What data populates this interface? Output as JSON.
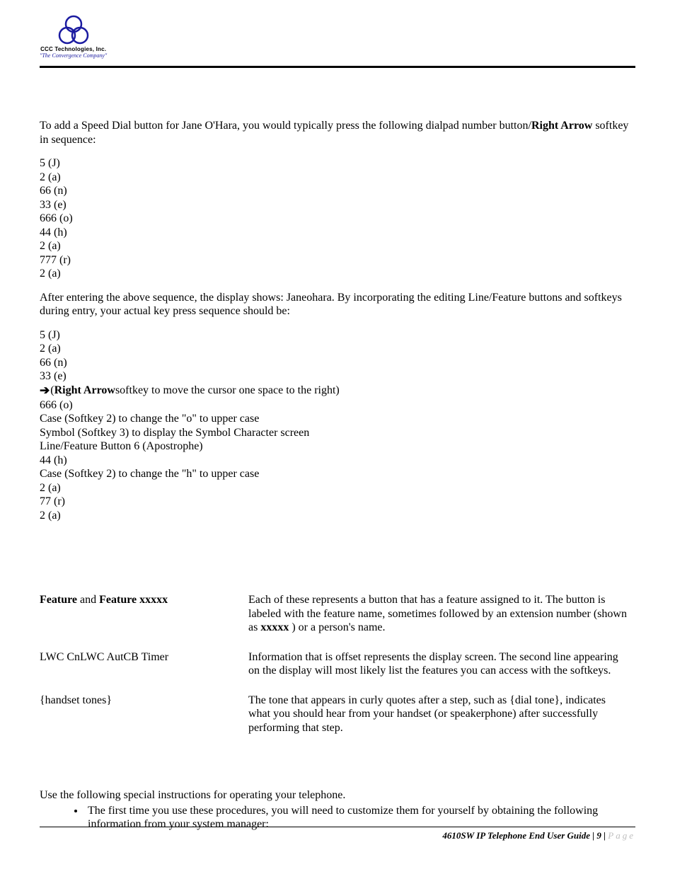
{
  "logo": {
    "company": "CCC Technologies, Inc.",
    "tagline": "\"The Convergence Company\""
  },
  "intro": {
    "pre": "To add a Speed Dial button for Jane O'Hara, you would typically press the following dialpad number button/",
    "bold": "Right Arrow",
    "post": " softkey in sequence:"
  },
  "seq1": [
    "5 (J)",
    "2 (a)",
    "66 (n)",
    "33 (e)",
    "666 (o)",
    "44 (h)",
    "2 (a)",
    "777 (r)",
    "2 (a)"
  ],
  "mid": "After entering the above sequence, the display shows: Janeohara. By incorporating the editing Line/Feature buttons and softkeys during entry, your actual key press sequence should be:",
  "seq2": {
    "l1": "5 (J)",
    "l2": "2 (a)",
    "l3": "66 (n)",
    "l4": "33 (e)",
    "l5_pre": "(",
    "l5_bold": "Right Arrow",
    "l5_post": " softkey to move the cursor one space to the right)",
    "l6": "666 (o)",
    "l7": "Case (Softkey 2) to change the \"o\" to upper case",
    "l8": "Symbol (Softkey 3) to display the Symbol Character screen",
    "l9": "Line/Feature Button 6 (Apostrophe)",
    "l10": "44 (h)",
    "l11": "Case (Softkey 2) to change the \"h\" to upper case",
    "l12": "2 (a)",
    "l13": "77 (r)",
    "l14": "2 (a)"
  },
  "defs": {
    "r1": {
      "term_b1": "Feature",
      "term_mid": " and ",
      "term_b2": "Feature xxxxx",
      "desc_pre": "Each of these represents a button that has a feature assigned to it. The button is labeled with the feature name, sometimes followed by an extension number (shown as ",
      "desc_bold": "xxxxx",
      "desc_post": " ) or a person's name."
    },
    "r2": {
      "term": "LWC CnLWC AutCB Timer",
      "desc": "Information that is offset represents the display screen. The second line appearing on the display will most likely list the features you can access with the softkeys."
    },
    "r3": {
      "term": "{handset tones}",
      "desc": "The tone that appears in curly quotes after a step, such as {dial tone}, indicates what you should hear from your handset (or speakerphone) after successfully performing that step."
    }
  },
  "instr": {
    "lead": "Use the following special instructions for operating your telephone.",
    "b1": "The first time you use these procedures, you will need to customize them for yourself by obtaining the following information from your system manager:"
  },
  "footer": {
    "doc": "4610SW IP Telephone End User Guide",
    "sep": " | ",
    "pagenum": "9",
    "pageword": "Page"
  }
}
